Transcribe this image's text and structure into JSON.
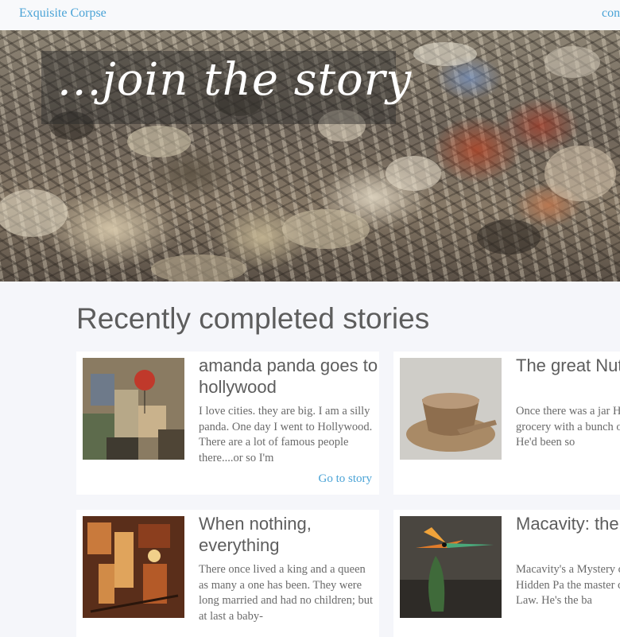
{
  "nav": {
    "brand": "Exquisite Corpse",
    "right_link": "con"
  },
  "hero": {
    "tagline": "...join the story"
  },
  "section": {
    "title": "Recently completed stories"
  },
  "stories": [
    {
      "title": "amanda panda goes to hollywood",
      "excerpt": "I love cities. they are big. I am a silly panda. One day I went to Hollywood. There are a lot of famous people there....or so I'm",
      "link": "Go to story"
    },
    {
      "title": "The great Nut caper",
      "excerpt": "Once there was a jar He was on a grocery with a bunch of othe Nutella. He'd been so"
    },
    {
      "title": "When nothing, everything",
      "excerpt": "There once lived a king and a queen as many a one has been. They were long married and had no children; but at last a baby-"
    },
    {
      "title": "Macavity: the cat",
      "excerpt": "Macavity's a Mystery called the Hidden Pa the master criminal the Law. He's the ba"
    }
  ],
  "colors": {
    "link": "#4aa3d6",
    "heading": "#5d5d5d",
    "page_bg": "#f5f6fa",
    "card_bg": "#ffffff"
  }
}
